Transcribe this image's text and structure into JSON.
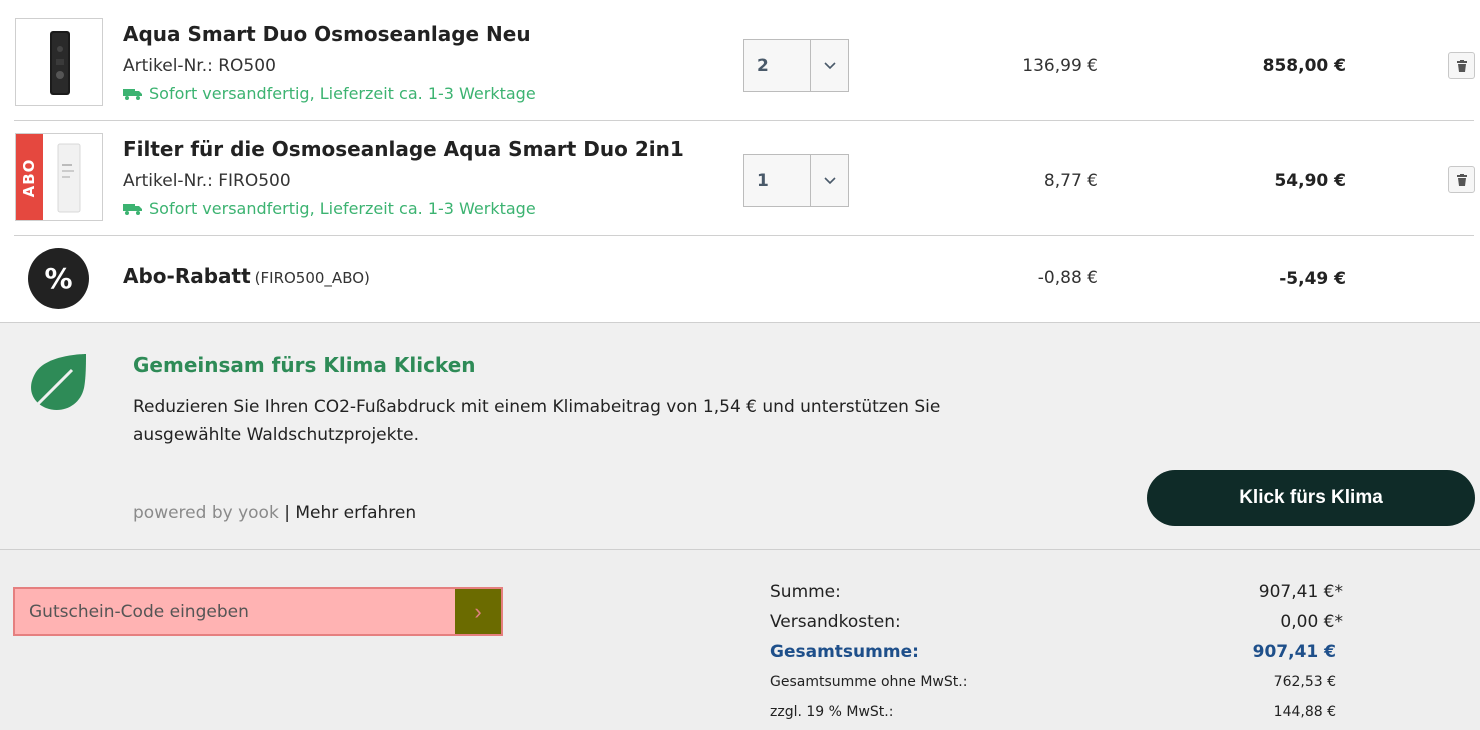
{
  "cart": {
    "items": [
      {
        "title": "Aqua Smart Duo Osmoseanlage Neu",
        "article": "Artikel-Nr.: RO500",
        "shipping": "Sofort versandfertig, Lieferzeit ca. 1-3 Werktage",
        "quantity": "2",
        "unit_price": "136,99 €",
        "total_price": "858,00 €"
      },
      {
        "title": "Filter für die Osmoseanlage Aqua Smart Duo 2in1",
        "article": "Artikel-Nr.: FIRO500",
        "shipping": "Sofort versandfertig, Lieferzeit ca. 1-3 Werktage",
        "quantity": "1",
        "unit_price": "8,77 €",
        "total_price": "54,90 €",
        "badge": "ABO"
      }
    ],
    "discount": {
      "icon_symbol": "%",
      "title": "Abo-Rabatt",
      "code": "(FIRO500_ABO)",
      "unit_price": "-0,88 €",
      "total_price": "-5,49 €"
    }
  },
  "klima": {
    "title": "Gemeinsam fürs Klima Klicken",
    "text": "Reduzieren Sie Ihren CO2-Fußabdruck mit einem Klimabeitrag von 1,54 € und unterstützen Sie ausgewählte Waldschutzprojekte.",
    "powered_by": "powered by yook",
    "separator": "|",
    "more_link": "Mehr erfahren",
    "button_label": "Klick fürs Klima",
    "accent_color": "#2e8b57"
  },
  "coupon": {
    "placeholder": "Gutschein-Code eingeben",
    "submit_symbol": "›"
  },
  "summary": {
    "subtotal_label": "Summe:",
    "subtotal_value": "907,41 €*",
    "shipping_label": "Versandkosten:",
    "shipping_value": "0,00 €*",
    "grand_label": "Gesamtsumme:",
    "grand_value": "907,41 €",
    "net_label": "Gesamtsumme ohne MwSt.:",
    "net_value": "762,53 €",
    "vat_label": "zzgl. 19 % MwSt.:",
    "vat_value": "144,88 €"
  },
  "icons": {
    "shipping": "truck-icon",
    "quantity": "chevron-down-icon",
    "remove": "trash-icon",
    "discount": "percent-icon",
    "klima": "leaf-icon"
  }
}
